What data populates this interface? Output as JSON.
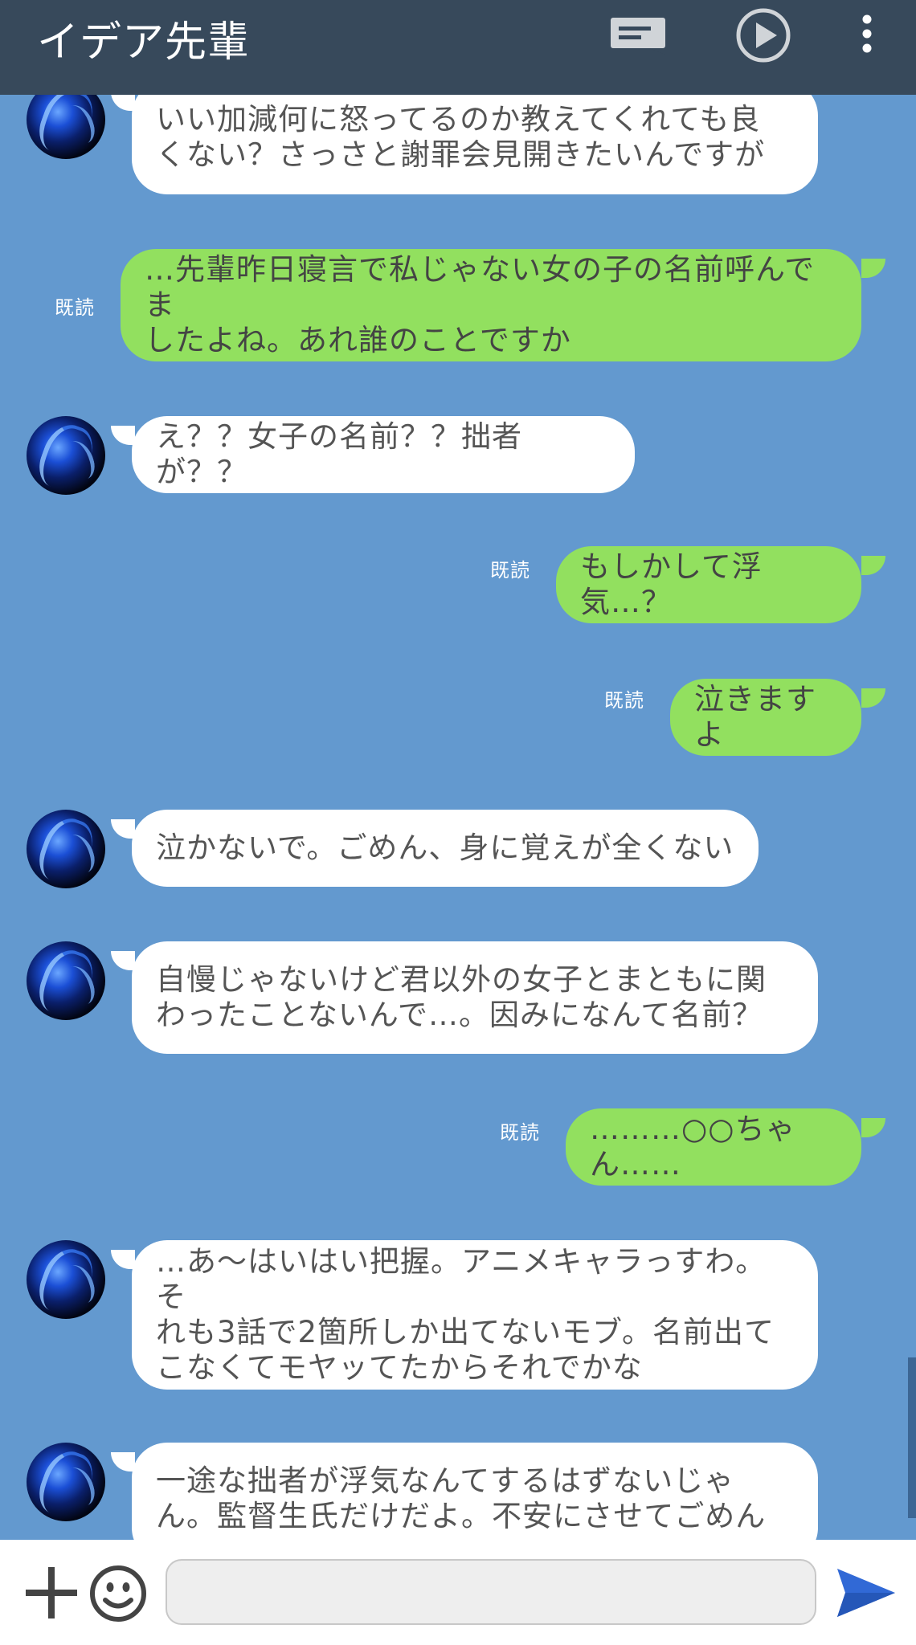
{
  "header": {
    "title": "イデア先輩",
    "icons": [
      "message-list-icon",
      "play-circle-icon",
      "more-vert-icon"
    ]
  },
  "messages": [
    {
      "side": "in",
      "lines": [
        "いい加減何に怒ってるのか教えてくれても良",
        "くない？さっさと謝罪会見開きたいんですが"
      ]
    },
    {
      "side": "out",
      "read": "既読",
      "lines": [
        "…先輩昨日寝言で私じゃない女の子の名前呼んでま",
        "したよね。あれ誰のことですか"
      ]
    },
    {
      "side": "in",
      "lines": [
        "え？？女子の名前？？拙者が？？"
      ]
    },
    {
      "side": "out",
      "read": "既読",
      "lines": [
        "もしかして浮気…？"
      ]
    },
    {
      "side": "out",
      "read": "既読",
      "lines": [
        "泣きますよ"
      ]
    },
    {
      "side": "in",
      "lines": [
        "泣かないで。ごめん、身に覚えが全くない"
      ]
    },
    {
      "side": "in",
      "lines": [
        "自慢じゃないけど君以外の女子とまともに関",
        "わったことないんで…。因みになんて名前？"
      ]
    },
    {
      "side": "out",
      "read": "既読",
      "lines": [
        "………○○ちゃん……"
      ]
    },
    {
      "side": "in",
      "lines": [
        "…あ〜はいはい把握。アニメキャラっすわ。そ",
        "れも3話で2箇所しか出てないモブ。名前出て",
        "こなくてモヤッてたからそれでかな"
      ]
    },
    {
      "side": "in",
      "lines": [
        "一途な拙者が浮気なんてするはずないじゃ",
        "ん。監督生氏だけだよ。不安にさせてごめん"
      ]
    }
  ],
  "input": {
    "placeholder": "",
    "icons": [
      "plus-icon",
      "emoji-icon",
      "send-icon"
    ]
  },
  "colors": {
    "header_bg": "#37495b",
    "chat_bg": "#6399cf",
    "incoming_bubble": "#ffffff",
    "outgoing_bubble": "#92e05f"
  }
}
